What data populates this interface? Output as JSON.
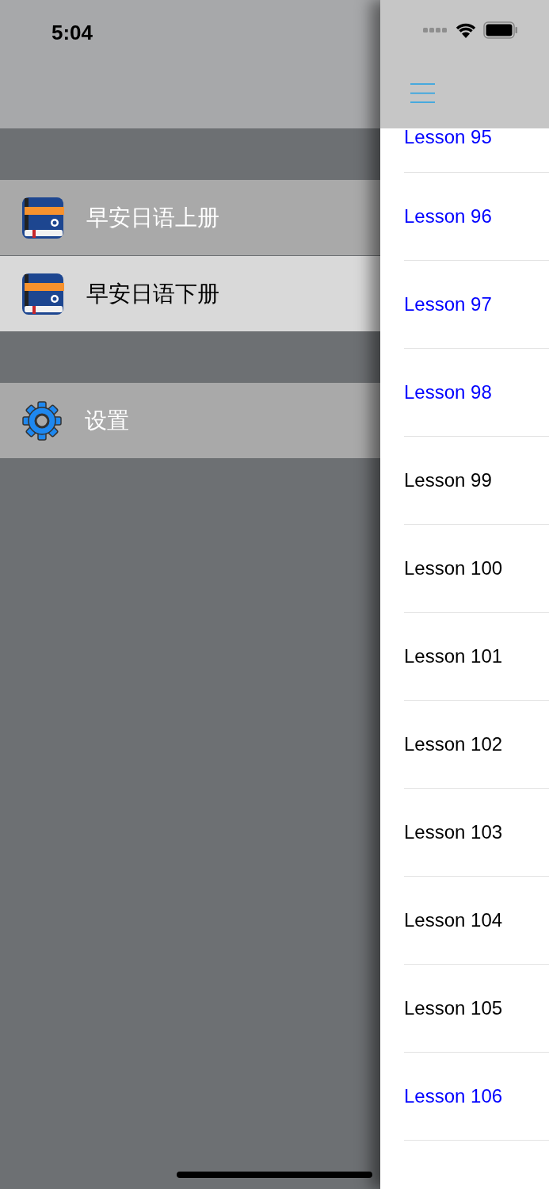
{
  "status_bar": {
    "time": "5:04"
  },
  "menu": {
    "sections": [
      {
        "items": [
          {
            "label": "早安日语上册",
            "kind": "book",
            "selected": false
          },
          {
            "label": "早安日语下册",
            "kind": "book",
            "selected": true
          }
        ]
      },
      {
        "items": [
          {
            "label": "设置",
            "kind": "settings",
            "selected": false
          }
        ]
      }
    ]
  },
  "lessons": [
    {
      "title": "Lesson 95",
      "color": "#0000ff"
    },
    {
      "title": "Lesson 96",
      "color": "#0000ff"
    },
    {
      "title": "Lesson 97",
      "color": "#0000ff"
    },
    {
      "title": "Lesson 98",
      "color": "#0000ff"
    },
    {
      "title": "Lesson 99",
      "color": "#000000"
    },
    {
      "title": "Lesson 100",
      "color": "#000000"
    },
    {
      "title": "Lesson 101",
      "color": "#000000"
    },
    {
      "title": "Lesson 102",
      "color": "#000000"
    },
    {
      "title": "Lesson 103",
      "color": "#000000"
    },
    {
      "title": "Lesson 104",
      "color": "#000000"
    },
    {
      "title": "Lesson 105",
      "color": "#000000"
    },
    {
      "title": "Lesson 106",
      "color": "#0000ff"
    }
  ]
}
